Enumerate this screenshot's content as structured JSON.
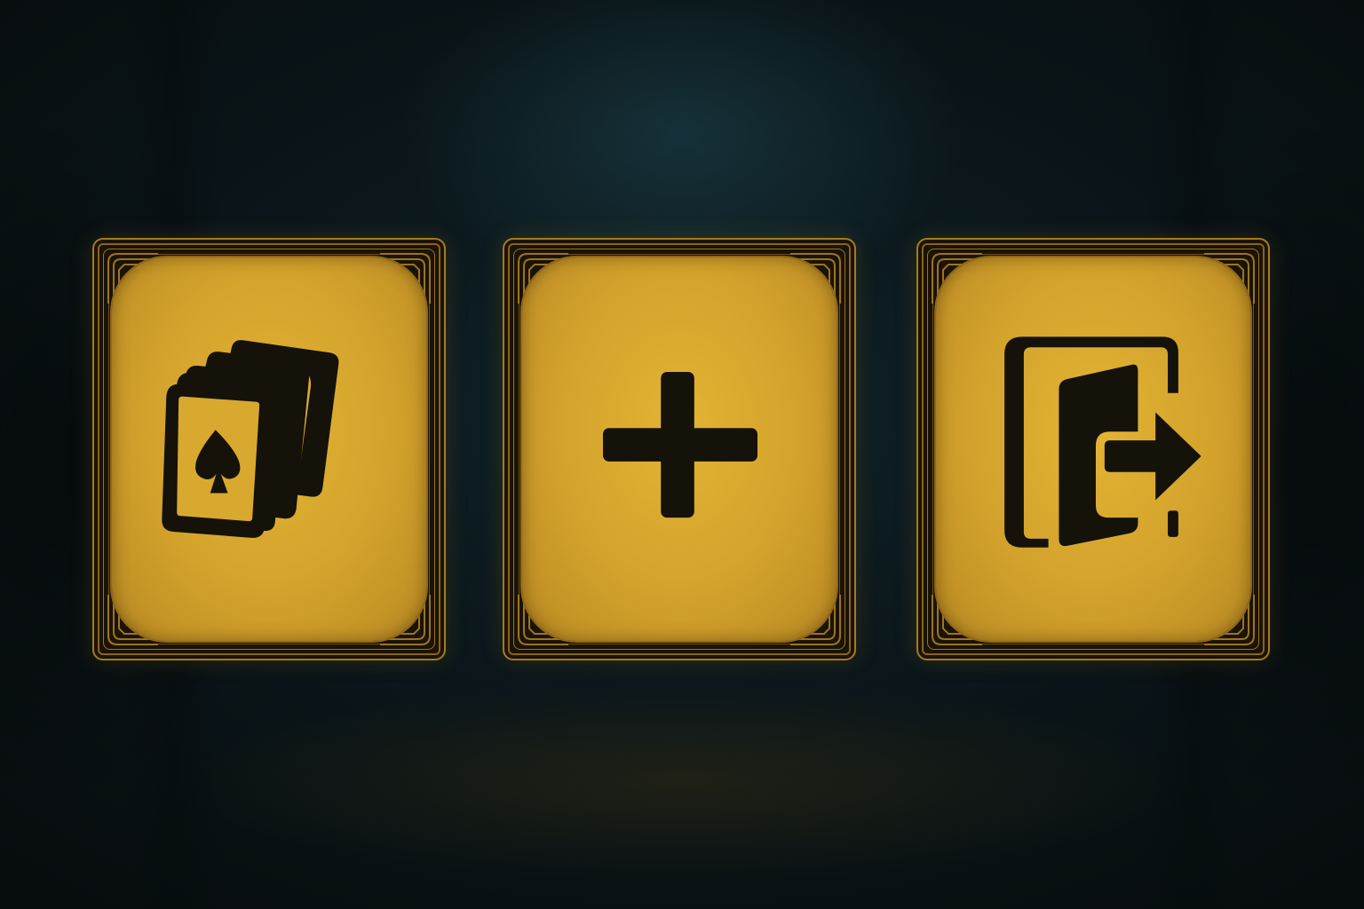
{
  "screen": {
    "type": "main-menu"
  },
  "colors": {
    "background": "#0b171b",
    "card_face": "#d9a82e",
    "card_border": "#a57a1f",
    "icon": "#15120a"
  },
  "menu": {
    "items": [
      {
        "id": "cards",
        "icon": "playing-cards-icon"
      },
      {
        "id": "add",
        "icon": "plus-icon"
      },
      {
        "id": "exit",
        "icon": "exit-door-icon"
      }
    ]
  }
}
